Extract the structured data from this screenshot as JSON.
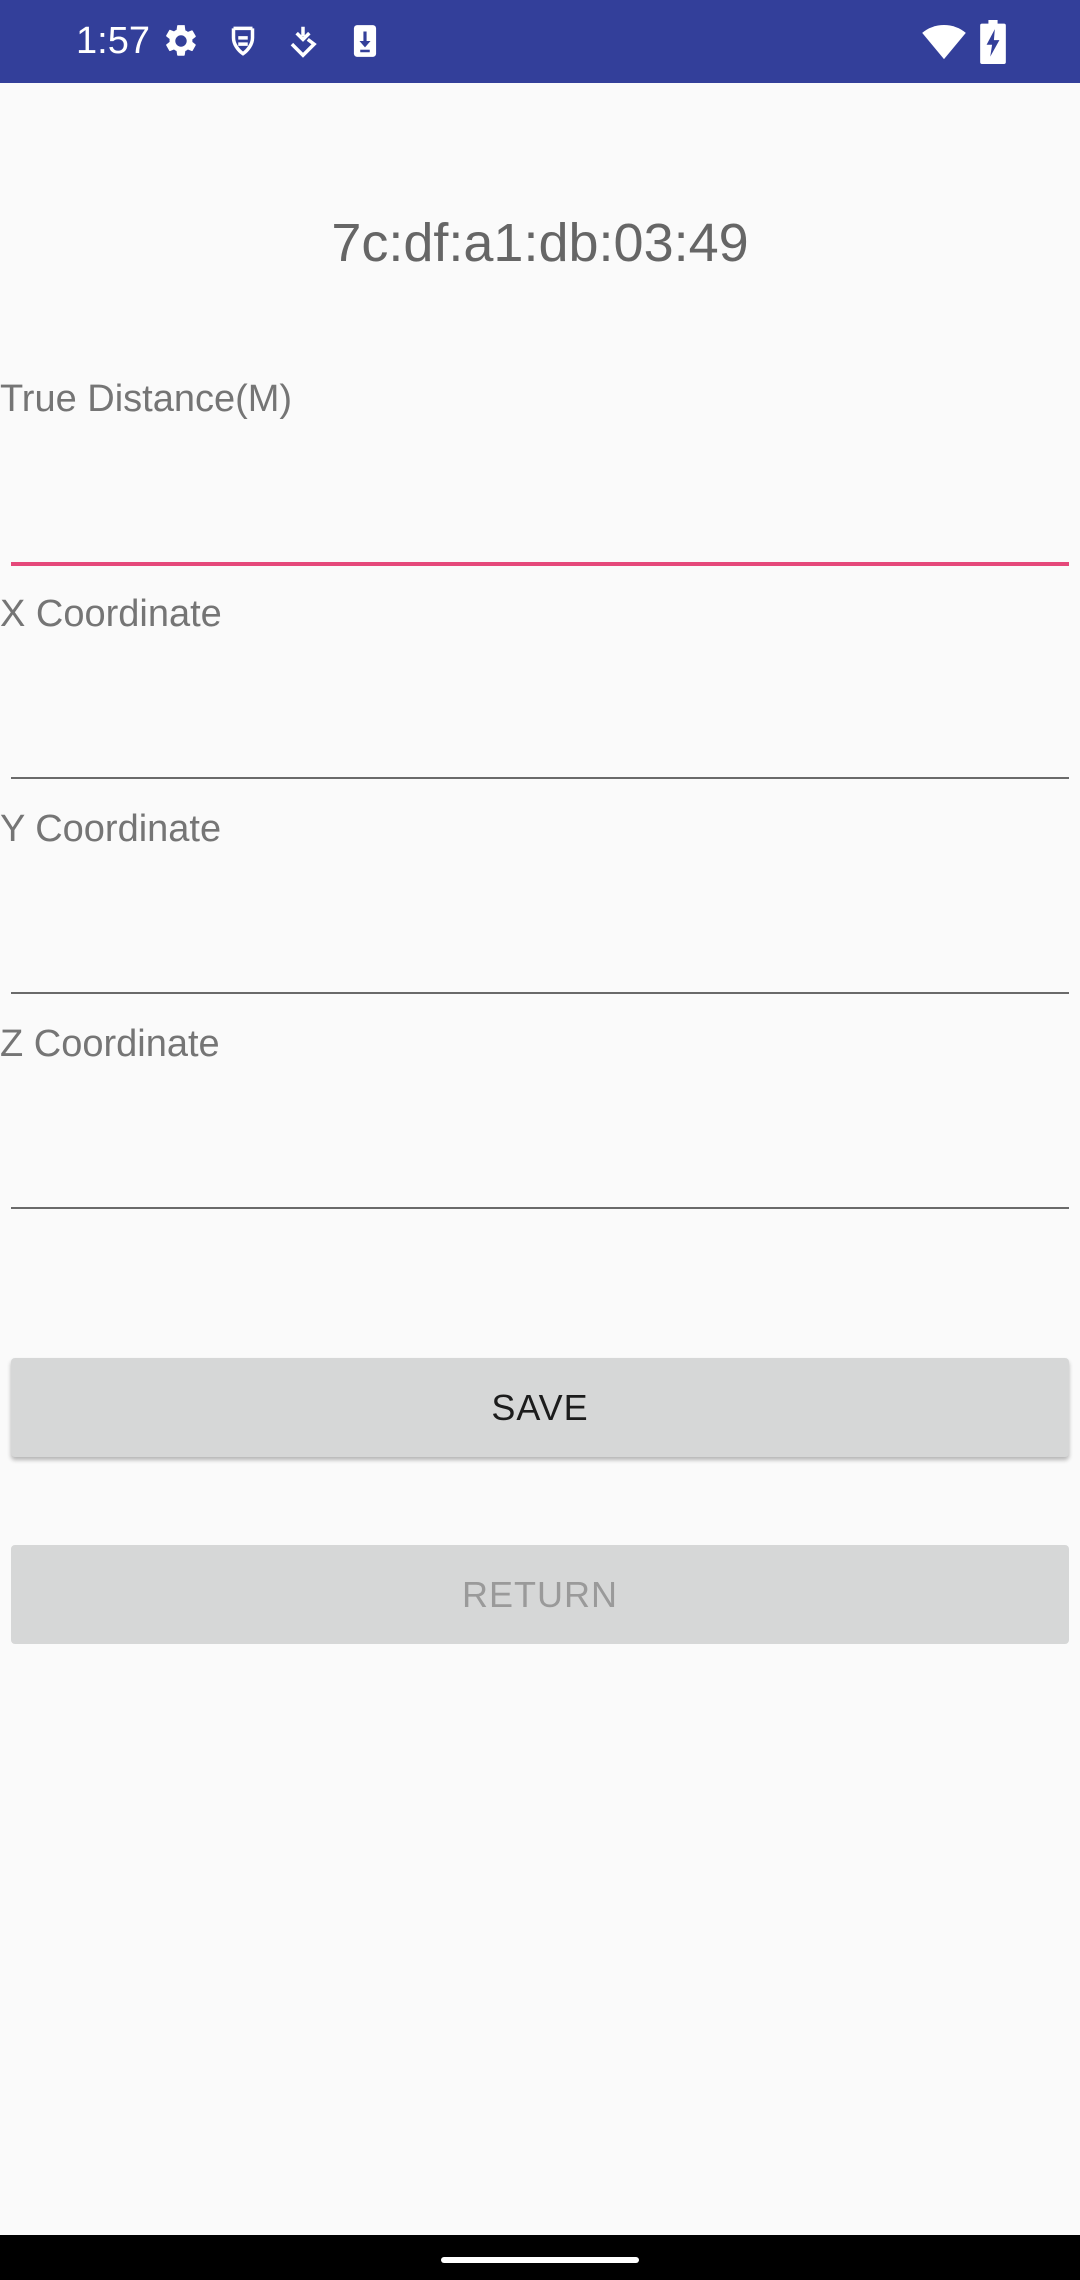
{
  "status_bar": {
    "time": "1:57",
    "icons_left": [
      "settings-icon",
      "face-id-icon",
      "download-status-icon",
      "device-update-icon"
    ],
    "icons_right": [
      "wifi-icon",
      "battery-charging-icon"
    ],
    "background_color": "#333f9a"
  },
  "device": {
    "address": "7c:df:a1:db:03:49"
  },
  "form": {
    "true_distance_label": "True Distance(M)",
    "true_distance_value": "",
    "x_label": "X Coordinate",
    "x_value": "",
    "y_label": "Y Coordinate",
    "y_value": "",
    "z_label": "Z Coordinate",
    "z_value": "",
    "focus_color": "#e5487a"
  },
  "buttons": {
    "save_label": "SAVE",
    "return_label": "RETURN"
  }
}
